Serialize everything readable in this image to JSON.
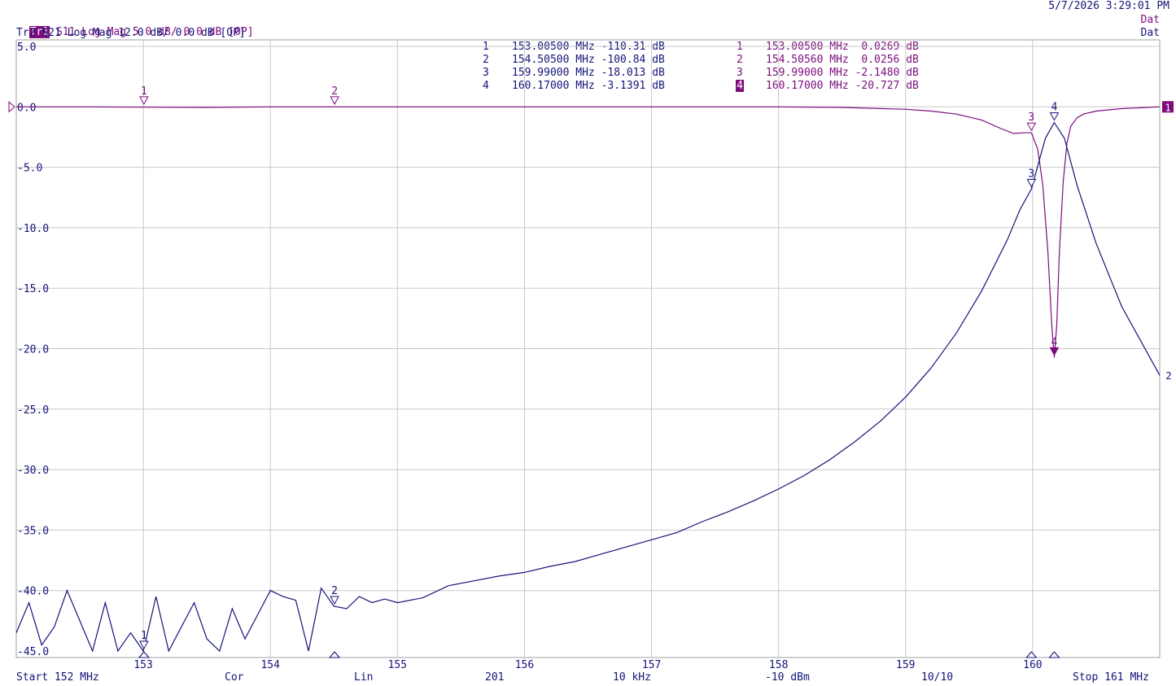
{
  "header": {
    "datetime": "5/7/2026 3:29:01 PM",
    "tr1_badge": "Tr1",
    "tr1_label": "S11 Log Mag 5.0 dB/ 0.0 dB [OP]",
    "tr2_label": "Tr2 S21 Log Mag 12.0 dB/ 0.0 dB [OP]",
    "dat1": "Dat",
    "dat2": "Dat"
  },
  "markers_tr2": [
    {
      "n": "1",
      "freq": "153.00500 MHz",
      "val": "-110.31 dB"
    },
    {
      "n": "2",
      "freq": "154.50500 MHz",
      "val": "-100.84 dB"
    },
    {
      "n": "3",
      "freq": "159.99000 MHz",
      "val": "-18.013 dB"
    },
    {
      "n": "4",
      "freq": "160.17000 MHz",
      "val": "-3.1391 dB"
    }
  ],
  "markers_tr1": [
    {
      "n": "1",
      "freq": "153.00500 MHz",
      "val": " 0.0269 dB"
    },
    {
      "n": "2",
      "freq": "154.50560 MHz",
      "val": " 0.0256 dB"
    },
    {
      "n": "3",
      "freq": "159.99000 MHz",
      "val": "-2.1480 dB"
    },
    {
      "n": "4",
      "freq": "160.17000 MHz",
      "val": "-20.727 dB"
    }
  ],
  "footer": {
    "start": "Start 152 MHz",
    "cor": "Cor",
    "lin": "Lin",
    "points": "201",
    "ifbw": "10 kHz",
    "power": "-10 dBm",
    "avg": "10/10",
    "stop": "Stop 161 MHz"
  },
  "colors": {
    "tr1": "#7d0c7d",
    "tr2": "#14147a",
    "grid": "#c8c8c8"
  },
  "chart_data": {
    "type": "line",
    "xlim": [
      152,
      161
    ],
    "ylim": [
      -45,
      5
    ],
    "y_tick_labels": [
      "5.0",
      "0.0",
      "-5.0",
      "-10.0",
      "-15.0",
      "-20.0",
      "-25.0",
      "-30.0",
      "-35.0",
      "-40.0",
      "-45.0"
    ],
    "x_tick_labels": [
      "153",
      "154",
      "155",
      "156",
      "157",
      "158",
      "159",
      "160"
    ],
    "trace_end_labels": {
      "tr1": "1",
      "tr2": "2"
    },
    "series": [
      {
        "name": "S11",
        "x": [
          152,
          152.5,
          153,
          153.5,
          154,
          154.5,
          155,
          155.5,
          156,
          156.5,
          157,
          157.5,
          158,
          158.5,
          159,
          159.2,
          159.4,
          159.6,
          159.75,
          159.85,
          159.93,
          159.99,
          160.04,
          160.08,
          160.12,
          160.15,
          160.17,
          160.19,
          160.21,
          160.24,
          160.27,
          160.3,
          160.35,
          160.4,
          160.5,
          160.7,
          161
        ],
        "y": [
          0,
          0,
          -0.03,
          -0.05,
          0,
          0,
          0,
          0,
          0,
          0,
          0,
          0,
          0,
          -0.05,
          -0.2,
          -0.35,
          -0.6,
          -1.1,
          -1.8,
          -2.2,
          -2.15,
          -2.148,
          -3.5,
          -6.5,
          -12,
          -18,
          -20.727,
          -18,
          -12,
          -6.2,
          -3,
          -1.6,
          -0.9,
          -0.6,
          -0.35,
          -0.15,
          0
        ]
      },
      {
        "name": "S21",
        "x": [
          152,
          152.1,
          152.2,
          152.3,
          152.4,
          152.5,
          152.6,
          152.7,
          152.8,
          152.9,
          153,
          153.1,
          153.2,
          153.3,
          153.4,
          153.5,
          153.6,
          153.7,
          153.8,
          153.9,
          154,
          154.1,
          154.2,
          154.3,
          154.4,
          154.5,
          154.6,
          154.7,
          154.8,
          154.9,
          155,
          155.2,
          155.4,
          155.6,
          155.8,
          156,
          156.2,
          156.4,
          156.6,
          156.8,
          157,
          157.2,
          157.4,
          157.6,
          157.8,
          158,
          158.2,
          158.4,
          158.6,
          158.8,
          159,
          159.2,
          159.4,
          159.6,
          159.8,
          159.9,
          159.99,
          160.05,
          160.1,
          160.17,
          160.25,
          160.35,
          160.5,
          160.7,
          161
        ],
        "y": [
          -43.5,
          -41,
          -44.5,
          -43,
          -40,
          -42.5,
          -45,
          -41,
          -45,
          -43.5,
          -45,
          -40.5,
          -45,
          -43,
          -41,
          -44,
          -45,
          -41.5,
          -44,
          -42,
          -40,
          -40.5,
          -40.8,
          -45,
          -39.8,
          -41.3,
          -41.5,
          -40.5,
          -41,
          -40.7,
          -41,
          -40.6,
          -39.6,
          -39.2,
          -38.8,
          -38.5,
          -38,
          -37.6,
          -37,
          -36.4,
          -35.8,
          -35.2,
          -34.3,
          -33.5,
          -32.6,
          -31.6,
          -30.5,
          -29.2,
          -27.7,
          -26,
          -24,
          -21.6,
          -18.7,
          -15.2,
          -11,
          -8.5,
          -6.8,
          -4.5,
          -2.6,
          -1.3,
          -2.6,
          -6.5,
          -11.3,
          -16.5,
          -22.2
        ]
      }
    ],
    "markers": [
      {
        "trace": "S11",
        "n": "1",
        "x": 153.005,
        "y": 0.0269
      },
      {
        "trace": "S11",
        "n": "2",
        "x": 154.5056,
        "y": 0.0256
      },
      {
        "trace": "S11",
        "n": "3",
        "x": 159.99,
        "y": -2.148
      },
      {
        "trace": "S11",
        "n": "4",
        "x": 160.17,
        "y": -20.727,
        "active": true
      },
      {
        "trace": "S21",
        "n": "1",
        "x": 153.005,
        "y": -45
      },
      {
        "trace": "S21",
        "n": "2",
        "x": 154.505,
        "y": -41.3
      },
      {
        "trace": "S21",
        "n": "3",
        "x": 159.99,
        "y": -6.8
      },
      {
        "trace": "S21",
        "n": "4",
        "x": 160.17,
        "y": -1.3
      }
    ]
  }
}
